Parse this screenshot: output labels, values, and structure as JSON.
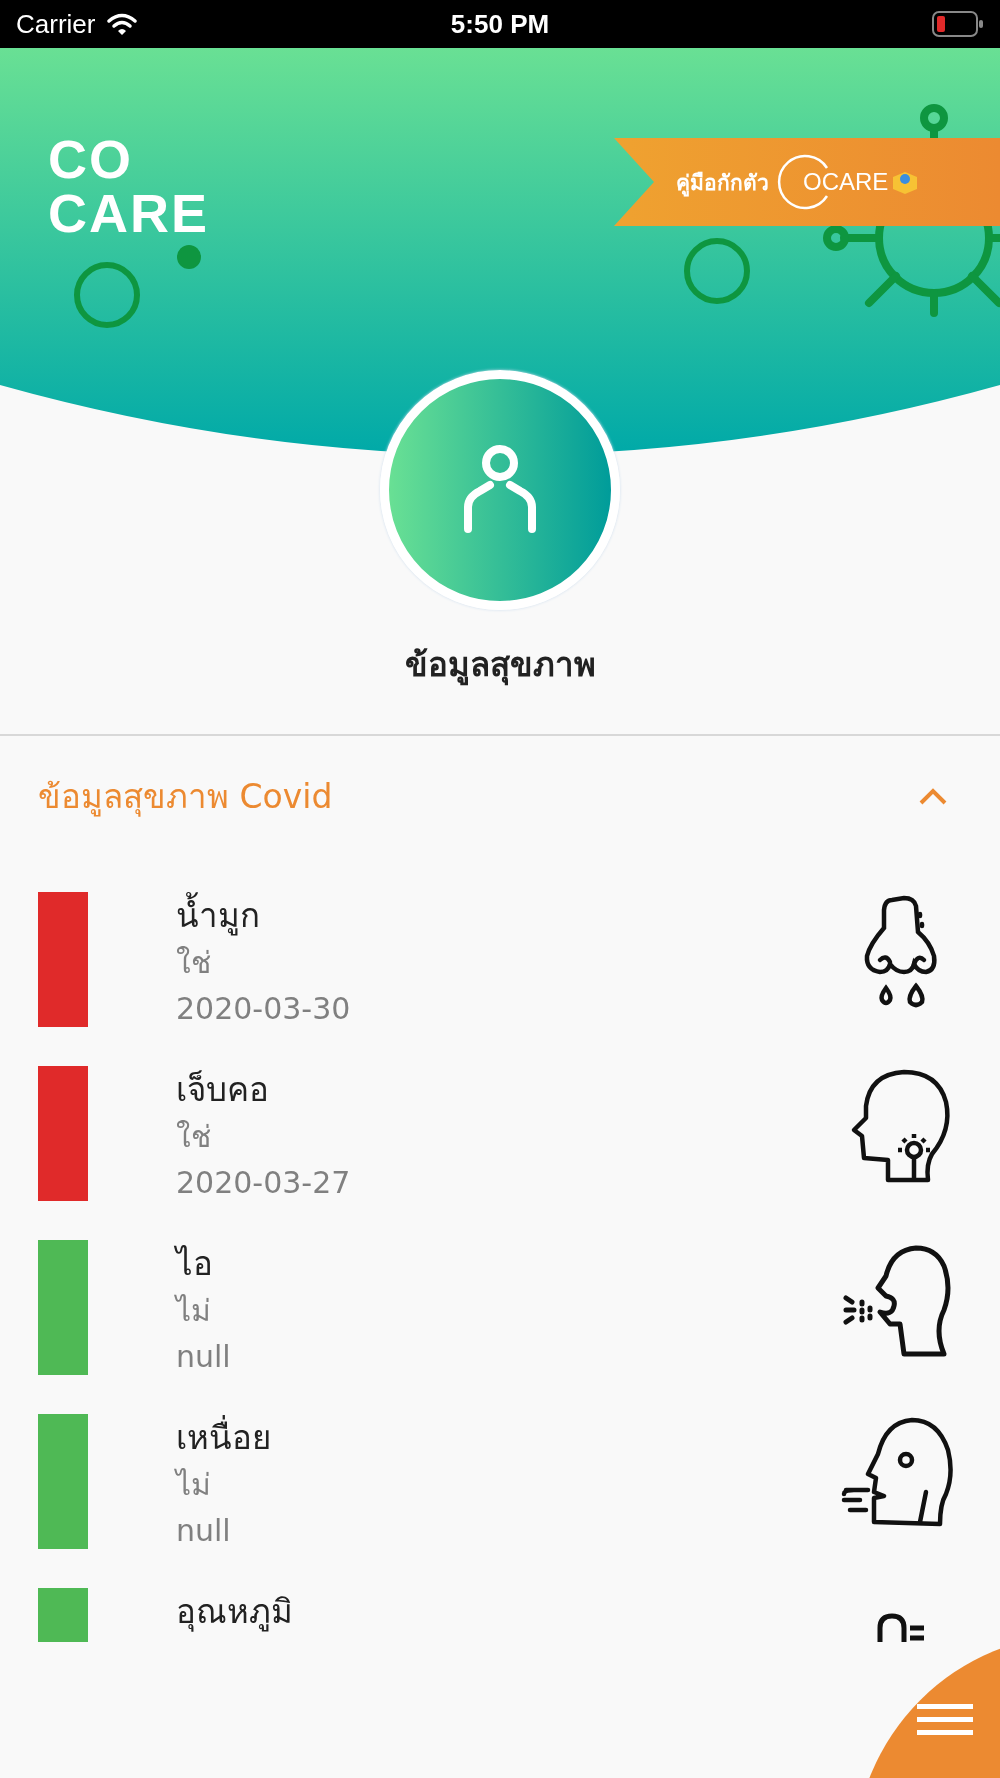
{
  "status_bar": {
    "carrier": "Carrier",
    "time": "5:50 PM"
  },
  "header": {
    "logo": [
      "CO",
      "CARE"
    ],
    "banner": {
      "label": "คู่มือกักตัว",
      "brand": "OCARE"
    }
  },
  "profile": {
    "title": "ข้อมูลสุขภาพ"
  },
  "section": {
    "title": "ข้อมูลสุขภาพ Covid",
    "expanded": true
  },
  "symptoms": [
    {
      "name": "น้ำมูก",
      "answer": "ใช่",
      "date": "2020-03-30",
      "color": "#e02a2a",
      "kind": "nose"
    },
    {
      "name": "เจ็บคอ",
      "answer": "ใช่",
      "date": "2020-03-27",
      "color": "#e02a2a",
      "kind": "throat"
    },
    {
      "name": "ไอ",
      "answer": "ไม่",
      "date": "null",
      "color": "#4fb955",
      "kind": "cough"
    },
    {
      "name": "เหนื่อย",
      "answer": "ไม่",
      "date": "null",
      "color": "#4fb955",
      "kind": "tired"
    },
    {
      "name": "อุณหภูมิ",
      "color": "#4fb955",
      "kind": "temperature"
    }
  ]
}
